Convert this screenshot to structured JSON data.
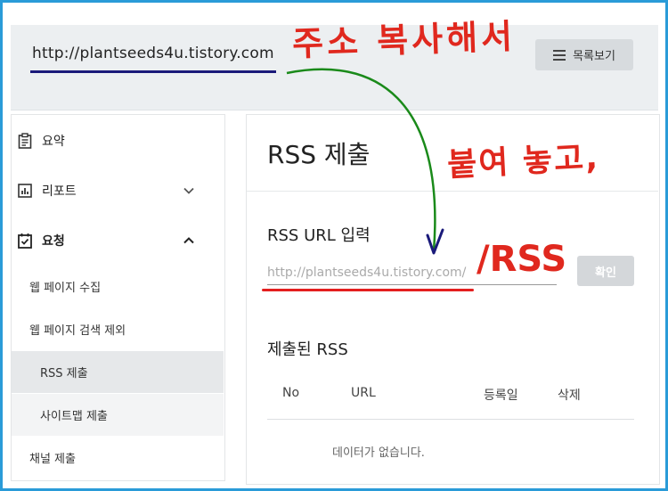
{
  "header": {
    "site_url": "http://plantseeds4u.tistory.com",
    "list_button_label": "목록보기"
  },
  "sidebar": {
    "items": [
      {
        "label": "요약",
        "icon": "clipboard-icon"
      },
      {
        "label": "리포트",
        "icon": "bar-chart-icon",
        "expanded": false
      },
      {
        "label": "요청",
        "icon": "checklist-icon",
        "expanded": true
      }
    ],
    "sub_items": [
      {
        "label": "웹 페이지 수집"
      },
      {
        "label": "웹 페이지 검색 제외"
      },
      {
        "label": "RSS 제출",
        "active": true
      },
      {
        "label": "사이트맵 제출"
      },
      {
        "label": "채널 제출"
      }
    ]
  },
  "main": {
    "title": "RSS 제출",
    "rss_input_label": "RSS URL 입력",
    "rss_input_value": "http://plantseeds4u.tistory.com/",
    "confirm_label": "확인",
    "submitted_title": "제출된 RSS",
    "table_headers": [
      "No",
      "URL",
      "등록일",
      "삭제"
    ],
    "empty_message": "데이터가 없습니다."
  },
  "annotations": {
    "copy_note": "주소 복사해서",
    "paste_note": "붙여 놓고,",
    "rss_suffix": "/RSS",
    "colors": {
      "red": "#e0281e",
      "green_arrow": "#1a8a1a",
      "frame": "#2a9bd8",
      "navy": "#1a1a7a"
    }
  }
}
